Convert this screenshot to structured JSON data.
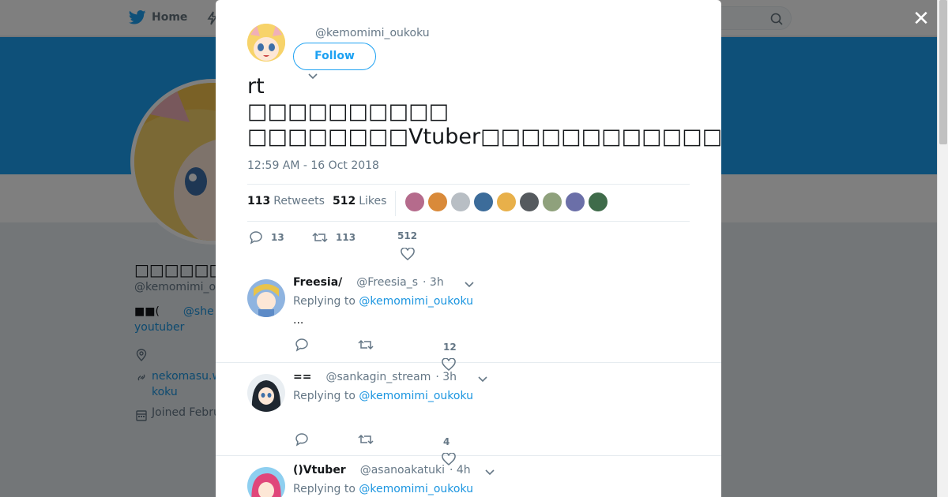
{
  "nav": {
    "home_label": "Home",
    "home_icon": "twitter-bird-icon"
  },
  "profile": {
    "name": "□□□□□□□□□□",
    "handle": "@kemomimi_o",
    "bio_prefix": "■■(",
    "bio_mention": "@she",
    "bio_line2": "youtuber",
    "link_line1": "nekomasu.w",
    "link_line2": "koku",
    "joined": "Joined Febru"
  },
  "tweet": {
    "handle": "@kemomimi_oukoku",
    "follow_label": "Follow",
    "text_line1": "rt",
    "text_line2": "□□□□□□□□□□",
    "text_line3": "□□□□□□□□Vtuber□□□□□□□□□□□□□□□□□□□□□□□□□□",
    "timestamp": "12:59 AM - 16 Oct 2018",
    "retweets_count": "113",
    "retweets_label": "Retweets",
    "likes_count": "512",
    "likes_label": "Likes",
    "reply_count": "13",
    "retweet_count": "113",
    "like_count": "512",
    "liker_colors": [
      "#b56b8c",
      "#d98a3a",
      "#b8bec4",
      "#3c6c9a",
      "#e8b04a",
      "#555a5e",
      "#8fa17c",
      "#6b6fa8",
      "#3f6b4a"
    ]
  },
  "replies": [
    {
      "name": "Freesia/",
      "handle": "@Freesia_s",
      "time": "· 3h",
      "replying_prefix": "Replying to",
      "replying_handle": "@kemomimi_oukoku",
      "body": "...",
      "like_count": "12",
      "avatar_color": "#5d8bc7"
    },
    {
      "name": "==",
      "handle": "@sankagin_stream",
      "time": "· 3h",
      "replying_prefix": "Replying to",
      "replying_handle": "@kemomimi_oukoku",
      "body": "",
      "like_count": "4",
      "avatar_color": "#2b3440"
    },
    {
      "name": "()Vtuber",
      "handle": "@asanoakatuki",
      "time": "· 4h",
      "replying_prefix": "Replying to",
      "replying_handle": "@kemomimi_oukoku",
      "body": "",
      "like_count": "",
      "avatar_color": "#e0467a"
    }
  ],
  "colors": {
    "accent": "#1da1f2",
    "link": "#1b95e0",
    "muted": "#657786"
  }
}
